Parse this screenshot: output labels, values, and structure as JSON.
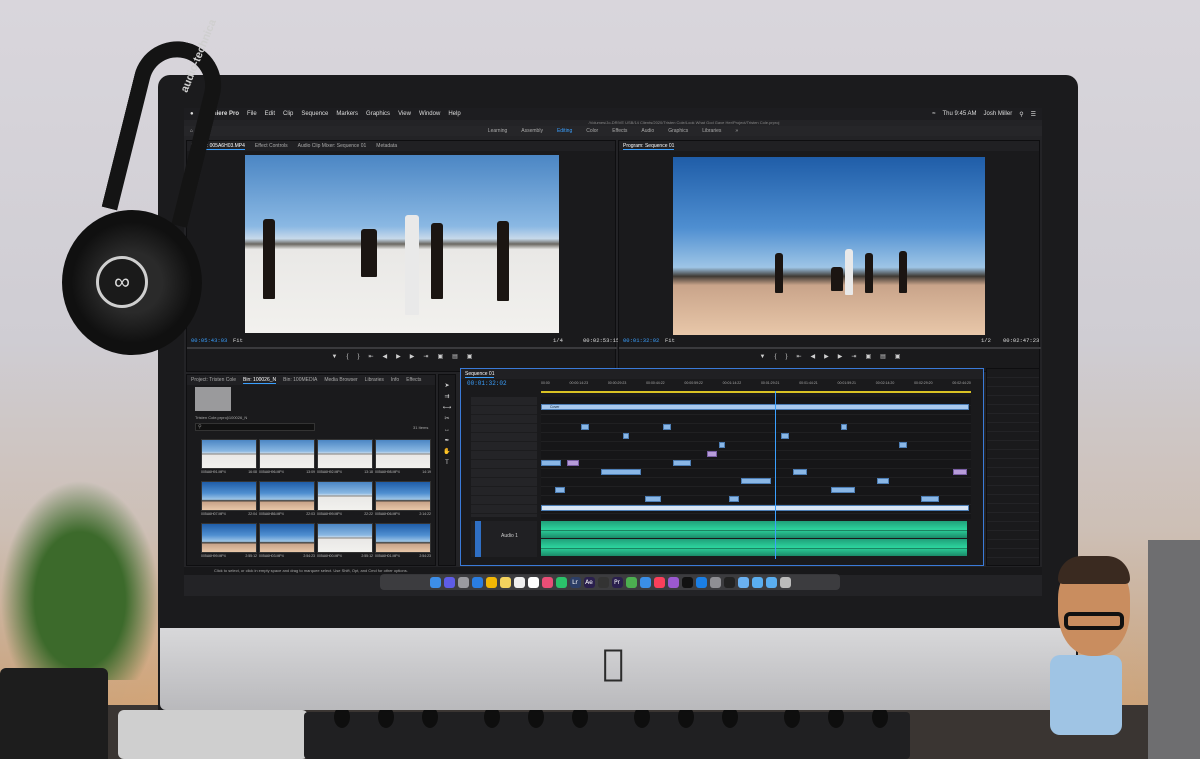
{
  "menubar": {
    "app_name": "Premiere Pro",
    "menus": [
      "File",
      "Edit",
      "Clip",
      "Sequence",
      "Markers",
      "Graphics",
      "View",
      "Window",
      "Help"
    ],
    "clock": "Thu 9:45 AM",
    "user": "Josh Miller",
    "project_path": "/Volumes/Jo-DRIVE USB/14 Clients/2020/Tristen Cole/Look What God Gave Her/Project/Tristen Cole.prproj"
  },
  "workspaces": {
    "items": [
      "Learning",
      "Assembly",
      "Editing",
      "Color",
      "Effects",
      "Audio",
      "Graphics",
      "Libraries",
      "»"
    ],
    "active": "Editing"
  },
  "source_monitor": {
    "tabs": [
      "Source: 005A6H03.MP4",
      "Effect Controls",
      "Audio Clip Mixer: Sequence 01",
      "Metadata"
    ],
    "timecode_in": "00:05:43:03",
    "timecode_out": "00:02:53:15",
    "fit": "Fit",
    "scale": "1/4"
  },
  "program_monitor": {
    "tab": "Program: Sequence 01",
    "timecode_in": "00:01:32:02",
    "timecode_out": "00:02:47:23",
    "fit": "Fit",
    "scale": "1/2"
  },
  "project_panel": {
    "tabs": [
      "Project: Tristen Cole",
      "Bin: 100026_N",
      "Bin: 100MEDIA",
      "Media Browser",
      "Libraries",
      "Info",
      "Effects"
    ],
    "path": "Tristen Cole.prproj\\100026_N",
    "item_count": "31 Items",
    "clips": [
      {
        "name": "005A6H91.MP4",
        "dur": "16:08"
      },
      {
        "name": "005A6H96.MP4",
        "dur": "13:09"
      },
      {
        "name": "005A6H92.MP4",
        "dur": "13:18"
      },
      {
        "name": "005A6H98.MP4",
        "dur": "14:19"
      },
      {
        "name": "005A6H07.MP4",
        "dur": "22:04"
      },
      {
        "name": "005A6H86.MP4",
        "dur": "22:03"
      },
      {
        "name": "005A6H99.MP4",
        "dur": "22:22"
      },
      {
        "name": "005A6H06.MP4",
        "dur": "2:14:22"
      },
      {
        "name": "005A6H99.MP4",
        "dur": "2:55:12"
      },
      {
        "name": "005A6H03.MP4",
        "dur": "2:54:23"
      },
      {
        "name": "005A6H00.MP4",
        "dur": "2:55:12"
      },
      {
        "name": "005A6H01.MP4",
        "dur": "2:54:23"
      }
    ]
  },
  "timeline": {
    "tab": "Sequence 01",
    "timecode": "00:01:32:02",
    "ruler": [
      "00:00",
      "00:00:14:23",
      "00:00:29:23",
      "00:00:44:22",
      "00:00:59:22",
      "00:01:14:22",
      "00:01:29:21",
      "00:01:44:21",
      "00:01:59:21",
      "00:02:14:20",
      "00:02:29:20",
      "00:02:44:20"
    ],
    "track_label": "Audio 1",
    "cover_clip": "Cover"
  },
  "status_bar": {
    "hint": "Click to select, or click in empty space and drag to marquee select. Use Shift, Opt, and Cmd for other options."
  },
  "dock": {
    "apps": [
      "Finder",
      "Siri",
      "Launchpad",
      "Safari",
      "Chrome",
      "Notes",
      "Reminders",
      "Calendar",
      "Photos",
      "Messages",
      "Lrc",
      "Ae",
      "DaVinci",
      "Pr",
      "Maps",
      "Mail",
      "Music",
      "Podcasts",
      "TV",
      "App Store",
      "Settings",
      "Terminal",
      "Preview",
      "Folder",
      "Folder",
      "Trash"
    ]
  },
  "colors": {
    "accent": "#3aa0ff",
    "clip_video": "#8ab7e6",
    "clip_audio": "#2dd39d",
    "panel_bg": "#1a1a1c"
  },
  "props": {
    "headphone_brand": "audio-technica"
  }
}
